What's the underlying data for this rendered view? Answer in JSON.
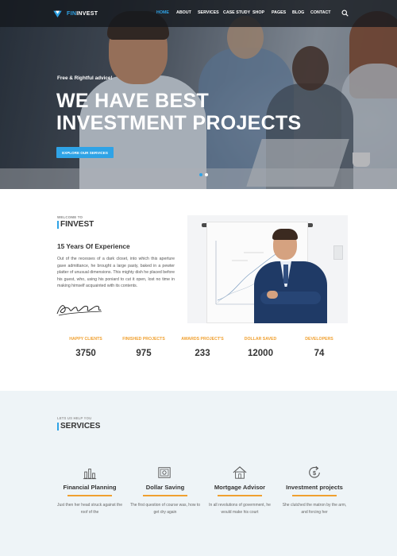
{
  "brand": {
    "name_part1": "FIN",
    "name_part2": "INVEST",
    "accent": "#2fa3e6"
  },
  "nav": [
    "HOME",
    "ABOUT",
    "SERVICES",
    "CASE STUDY",
    "SHOP",
    "PAGES",
    "BLOG",
    "CONTACT"
  ],
  "hero": {
    "tagline": "Free & Rightful advice!",
    "title_line1": "WE HAVE BEST",
    "title_line2": "INVESTMENT PROJECTS",
    "button": "EXPLORE OUR SERVICES"
  },
  "about": {
    "welcome": "WELCOME TO",
    "title": "FINVEST",
    "subtitle": "15 Years Of Experience",
    "paragraph": "Out of the recesses of a dark closet, into which this aperture gave admittance, he brought a large pasty, baked in a pewter platter of unusual dimensions. This mighty dish he placed before his guest, who, using his poniard to cut it open, lost no time in making himself acquainted with its contents."
  },
  "stats": [
    {
      "label": "HAPPY CLIENTS",
      "value": "3750"
    },
    {
      "label": "FINISHED PROJECTS",
      "value": "975"
    },
    {
      "label": "AWARDS PROJECT'S",
      "value": "233"
    },
    {
      "label": "DOLLAR SAVED",
      "value": "12000"
    },
    {
      "label": "DEVELOPERS",
      "value": "74"
    }
  ],
  "services": {
    "eyebrow": "LETS US HELP YOU",
    "title": "SERVICES",
    "items": [
      {
        "title": "Financial Planning",
        "text": "Just then her head struck against the roof of the",
        "icon": "bar-chart-icon"
      },
      {
        "title": "Dollar Saving",
        "text": "The first question of course was, how to get dry again",
        "icon": "safe-icon"
      },
      {
        "title": "Mortgage Advisor",
        "text": "In all revolutions of government, he would make his court",
        "icon": "house-icon"
      },
      {
        "title": "Investment projects",
        "text": "She clutched the matron by the arm, and forcing her",
        "icon": "dollar-refresh-icon"
      }
    ]
  },
  "colors": {
    "primary": "#2fa3e6",
    "highlight": "#f0a030",
    "services_bg": "#eef4f7"
  }
}
